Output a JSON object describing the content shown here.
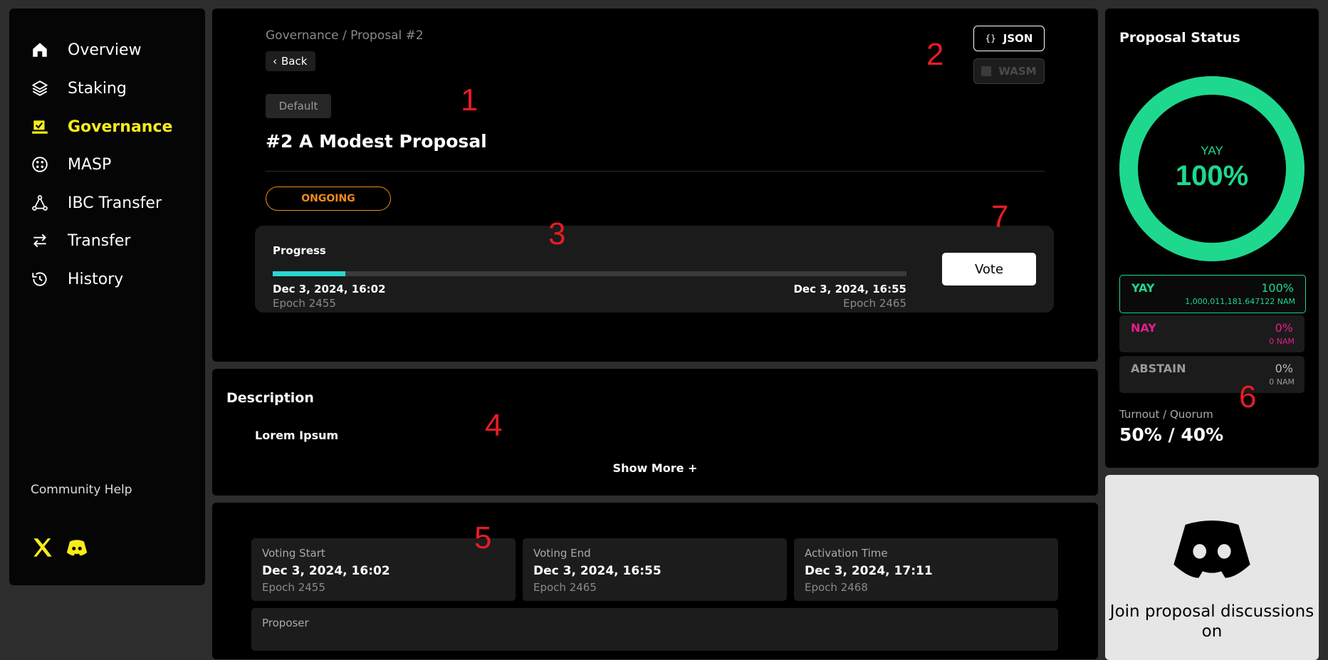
{
  "sidebar": {
    "items": [
      {
        "label": "Overview",
        "icon": "home-icon"
      },
      {
        "label": "Staking",
        "icon": "layers-icon"
      },
      {
        "label": "Governance",
        "icon": "ballot-icon",
        "active": true
      },
      {
        "label": "MASP",
        "icon": "masp-icon"
      },
      {
        "label": "IBC Transfer",
        "icon": "ibc-icon"
      },
      {
        "label": "Transfer",
        "icon": "transfer-arrows-icon"
      },
      {
        "label": "History",
        "icon": "history-icon"
      }
    ],
    "help": "Community Help",
    "social": [
      "x-icon",
      "discord-icon"
    ],
    "accent": "#f7ec1b"
  },
  "header": {
    "breadcrumb": "Governance / Proposal #2",
    "back": "Back",
    "tag": "Default",
    "title": "#2 A Modest Proposal",
    "status": "ONGOING",
    "json_btn": "JSON",
    "wasm_btn": "WASM",
    "progress": {
      "label": "Progress",
      "fraction": 0.115,
      "start_date": "Dec 3, 2024, 16:02",
      "start_epoch": "Epoch 2455",
      "end_date": "Dec 3, 2024, 16:55",
      "end_epoch": "Epoch 2465"
    },
    "vote": "Vote"
  },
  "description": {
    "title": "Description",
    "body": "Lorem Ipsum",
    "show_more": "Show More +"
  },
  "voting": {
    "cards": [
      {
        "label": "Voting Start",
        "value": "Dec 3, 2024, 16:02",
        "epoch": "Epoch 2455"
      },
      {
        "label": "Voting End",
        "value": "Dec 3, 2024, 16:55",
        "epoch": "Epoch 2465"
      },
      {
        "label": "Activation Time",
        "value": "Dec 3, 2024, 17:11",
        "epoch": "Epoch 2468"
      }
    ],
    "proposer_label": "Proposer"
  },
  "proposal_status": {
    "title": "Proposal Status",
    "center_label": "YAY",
    "center_value": "100%",
    "yay_fraction": 1.0,
    "votes": [
      {
        "key": "YAY",
        "pct": "100%",
        "amount": "1,000,011,181.647122 NAM",
        "color": "#1ed88e"
      },
      {
        "key": "NAY",
        "pct": "0%",
        "amount": "0 NAM",
        "color": "#e21e8c"
      },
      {
        "key": "ABSTAIN",
        "pct": "0%",
        "amount": "0 NAM",
        "color": "#9a9a9a"
      }
    ],
    "turnout_label": "Turnout / Quorum",
    "turnout_value": "50% / 40%"
  },
  "promo": {
    "text": "Join proposal discussions on"
  },
  "annotations": [
    "1",
    "2",
    "3",
    "4",
    "5",
    "6",
    "7"
  ]
}
